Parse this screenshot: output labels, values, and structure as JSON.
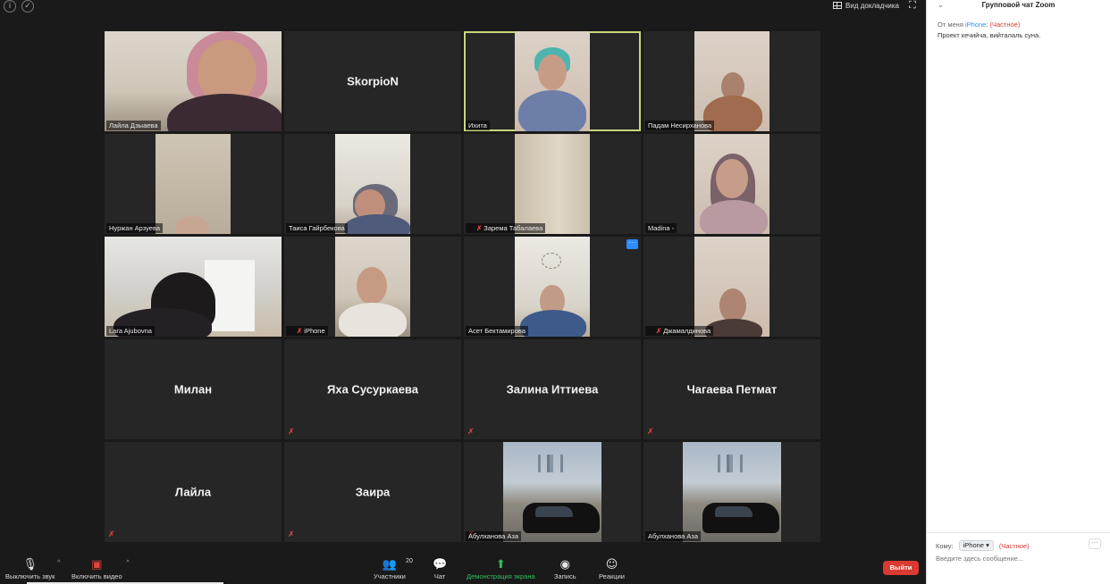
{
  "view_switch_label": "Вид докладчика",
  "participants": [
    {
      "name": "Лайла Дзыаева",
      "show_name": "Лайла Дзыаева",
      "video": true,
      "muted": false
    },
    {
      "name": "SkorpioN",
      "video": false,
      "muted": false
    },
    {
      "name": "Ихита",
      "video": true,
      "muted": false,
      "active_speaker": true
    },
    {
      "name": "Падам Несирханова",
      "video": true,
      "muted": false
    },
    {
      "name": "Нуржан Арзуева",
      "video": true,
      "muted": false
    },
    {
      "name": "Таиса Гайрбекова",
      "video": true,
      "muted": false
    },
    {
      "name": "Зарема Табалаева",
      "video": true,
      "muted": true
    },
    {
      "name": "Madina -",
      "video": true,
      "muted": false
    },
    {
      "name": "Lara Ajubovna",
      "video": true,
      "muted": false
    },
    {
      "name": "iPhone",
      "video": true,
      "muted": true
    },
    {
      "name": "Асет Бектамирова",
      "video": true,
      "muted": false,
      "more_button": "···"
    },
    {
      "name": "Джамалдинова",
      "video": true,
      "muted": true
    },
    {
      "name": "Милан",
      "video": false,
      "muted": false
    },
    {
      "name": "Яха Сусуркаева",
      "video": false,
      "muted": true
    },
    {
      "name": "Залина Иттиева",
      "video": false,
      "muted": true
    },
    {
      "name": "Чагаева Петмат",
      "video": false,
      "muted": true
    },
    {
      "name": "Лайла",
      "video": false,
      "muted": true
    },
    {
      "name": "Заира",
      "video": false,
      "muted": true
    },
    {
      "name": "Абулханова Аза",
      "video": true,
      "muted": false
    },
    {
      "name": "Абулханова Аза",
      "video": true,
      "muted": false
    }
  ],
  "toolbar": {
    "mute_label": "Выключить звук",
    "video_label": "Включить видео",
    "participants_label": "Участники",
    "participants_count": "20",
    "chat_label": "Чат",
    "share_label": "Демонстрация экрана",
    "record_label": "Запись",
    "reactions_label": "Реакции",
    "leave_label": "Выйти"
  },
  "chat": {
    "title": "Групповой чат Zoom",
    "message": {
      "prefix": "От меня",
      "recipient": "iPhone:",
      "private_tag": "(Частное)",
      "text": "Проект кечийча, вийталаль суна."
    },
    "to_label": "Кому:",
    "to_value": "iPhone",
    "to_private": "(Частное)",
    "more": "···",
    "input_placeholder": "Введите здесь сообщение..."
  },
  "colors": {
    "accent": "#2d8cff",
    "leave": "#d93a31",
    "share": "#2fbf5b",
    "active_border": "#c8d77a",
    "muted": "#e0463e"
  }
}
